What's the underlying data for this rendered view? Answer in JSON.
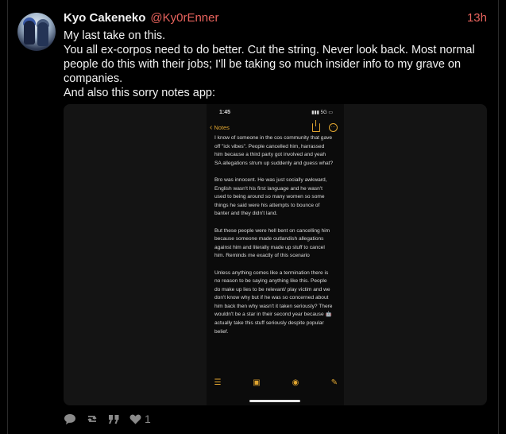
{
  "author": {
    "name": "Kyo Cakeneko",
    "handle": "@Ky0rEnner",
    "time": "13h"
  },
  "post": {
    "lines": [
      "My last take on this.",
      "You all ex-corpos need to do better. Cut the string. Never look back. Most normal people do this with their jobs; I'll be taking so much insider info to my grave on companies.",
      "And also this sorry notes app:"
    ]
  },
  "screenshot": {
    "clock": "1:45",
    "signal": "▮▮▮ 5G ▭",
    "back_label": "Notes",
    "note_paragraphs": [
      "I know of someone in the cos community that gave off \"ick vibes\". People cancelled him, harrassed him because a third party got involved and yeah SA allegations strum up suddenly and guess what?",
      "Bro was innocent. He was just socially awkward, English wasn't his first language and he wasn't used to being around so many women so some things he said were his attempts to bounce of banter and they didn't land.",
      "But these people were hell bent on cancelling him because someone made outlandish allegations against him and literally made up stuff to cancel him. Reminds me exactly of this scenario",
      "Unless anything comes like a termination there is no reason to be saying anything like this. People do make up lies to be relevant/ play victim and we don't know why but if he was so concerned about him back then why wasn't it taken seriously? There wouldn't be a star in their second year because 🤖 actually take this stuff seriously despite popular belief."
    ]
  },
  "actions": {
    "like_count": "1"
  },
  "colors": {
    "accent": "#e8635d",
    "notes_accent": "#e0a530",
    "background": "#000000"
  },
  "icons": [
    "reply-icon",
    "repost-icon",
    "quote-icon",
    "like-icon"
  ]
}
